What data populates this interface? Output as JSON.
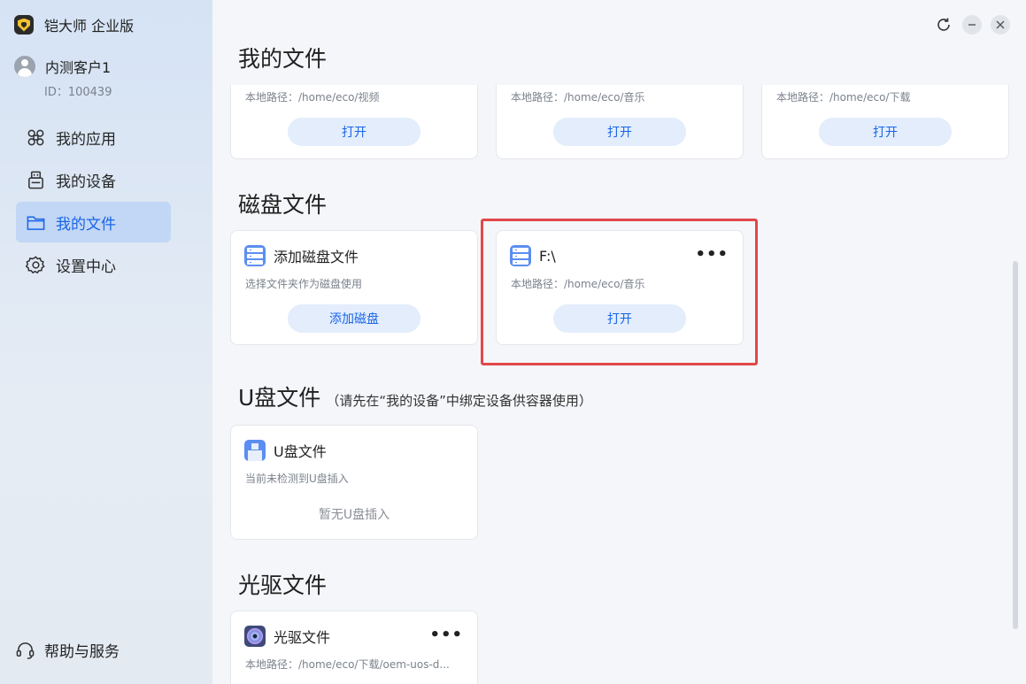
{
  "app": {
    "title": "铠大师 企业版"
  },
  "user": {
    "name": "内测客户1",
    "id_text": "ID：100439"
  },
  "nav": [
    {
      "label": "我的应用",
      "icon": "apps-icon",
      "active": false
    },
    {
      "label": "我的设备",
      "icon": "device-icon",
      "active": false
    },
    {
      "label": "我的文件",
      "icon": "folder-icon",
      "active": true
    },
    {
      "label": "设置中心",
      "icon": "gear-icon",
      "active": false
    }
  ],
  "help": {
    "label": "帮助与服务"
  },
  "sections": {
    "my_files": {
      "title": "我的文件"
    },
    "disk_files": {
      "title": "磁盘文件"
    },
    "usb_files": {
      "title": "U盘文件",
      "subtitle": "（请先在“我的设备”中绑定设备供容器使用）"
    },
    "optical_files": {
      "title": "光驱文件"
    }
  },
  "my_files_cards": [
    {
      "path": "本地路径：/home/eco/视频",
      "button": "打开"
    },
    {
      "path": "本地路径：/home/eco/音乐",
      "button": "打开"
    },
    {
      "path": "本地路径：/home/eco/下载",
      "button": "打开"
    }
  ],
  "disk_cards": {
    "add": {
      "title": "添加磁盘文件",
      "desc": "选择文件夹作为磁盘使用",
      "button": "添加磁盘"
    },
    "f_drive": {
      "title": "F:\\",
      "path": "本地路径：/home/eco/音乐",
      "button": "打开",
      "more": "•••"
    }
  },
  "usb_card": {
    "title": "U盘文件",
    "desc": "当前未检测到U盘插入",
    "empty": "暂无U盘插入"
  },
  "optical_card": {
    "title": "光驱文件",
    "path": "本地路径：/home/eco/下载/oem-uos-d...",
    "more": "•••"
  },
  "colors": {
    "accent": "#1865e8",
    "highlight": "#e2474a"
  }
}
